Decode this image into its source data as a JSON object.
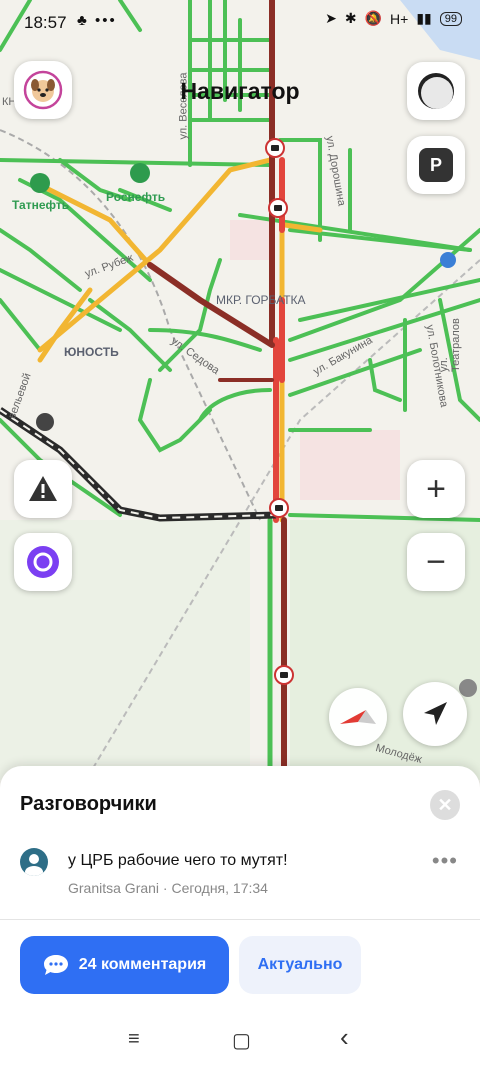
{
  "status_bar": {
    "time": "18:57",
    "left_icons": "♣ •••",
    "battery": "99",
    "network": "H+"
  },
  "app": {
    "title": "Навигатор"
  },
  "map_labels": {
    "tatneft": "Татнефть",
    "rosneft": "Роснефть",
    "yunost": "ЮНОСТЬ",
    "gorbatka": "МКР. ГОРБАТКА",
    "ul_rubezh": "ул. Рубеж",
    "ul_sedova": "ул. Седова",
    "ul_bakunina": "ул. Бакунина",
    "ul_teatralov": "ул. Театралов",
    "ul_bolotnikova": "ул. Болотникова",
    "ul_doroshina": "ул. Дорошина",
    "ul_veselova": "ул. Веселова",
    "ul_velyevoi": "вельевой",
    "ul_molodezh": "Молодёж",
    "kn": "КН"
  },
  "buttons": {
    "parking": "P",
    "zoom_in": "+",
    "zoom_out": "−"
  },
  "sheet": {
    "title": "Разговорчики",
    "close": "✕",
    "message": "у ЦРБ рабочие чего то мутят!",
    "author_line": "Granitsa Grani · Сегодня, 17:34",
    "more": "•••",
    "comments_button": "24 комментария",
    "actual_button": "Актуально"
  },
  "nav_bar": {
    "menu": "≡",
    "home": "▢",
    "back": "‹"
  },
  "colors": {
    "accent": "#2f6ff3",
    "traffic_red": "#e2453c",
    "traffic_dark": "#8b2e26",
    "traffic_yellow": "#f2b632",
    "traffic_green": "#4cc055"
  }
}
